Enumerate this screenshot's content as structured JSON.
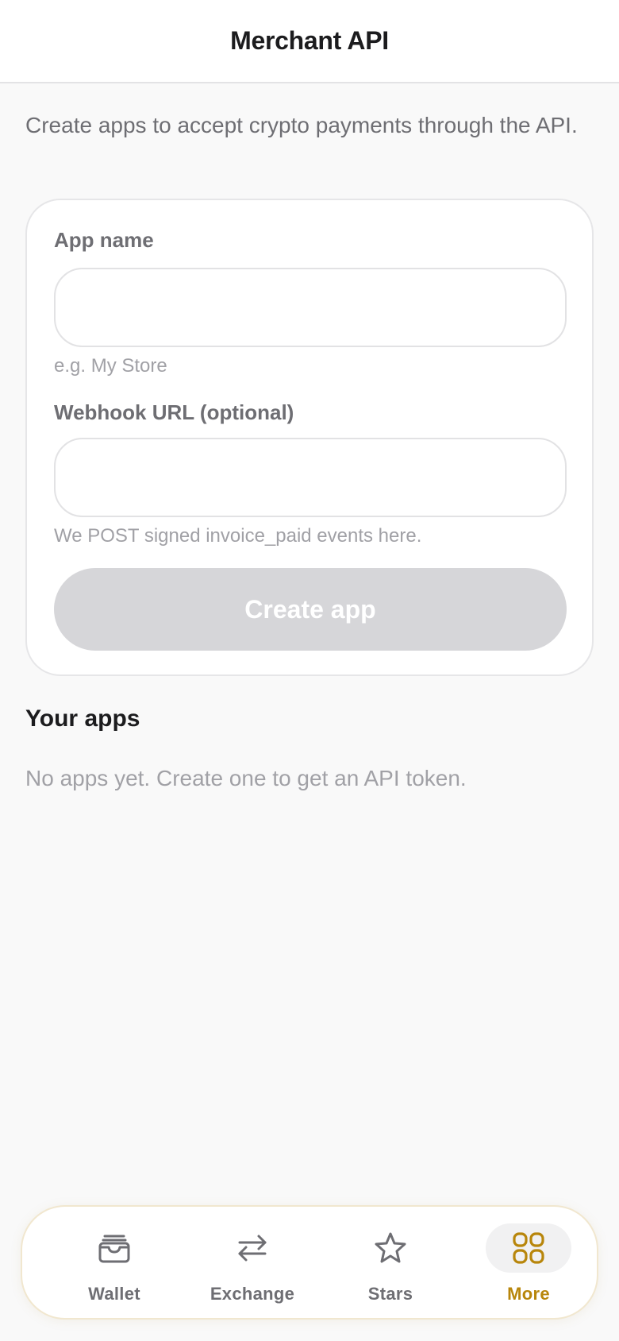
{
  "header": {
    "title": "Merchant API"
  },
  "intro": "Create apps to accept crypto payments through the API.",
  "form": {
    "app_name": {
      "label": "App name",
      "value": "",
      "hint": "e.g. My Store"
    },
    "webhook": {
      "label": "Webhook URL (optional)",
      "value": "",
      "hint": "We POST signed invoice_paid events here."
    },
    "create_label": "Create app"
  },
  "apps": {
    "title": "Your apps",
    "empty": "No apps yet. Create one to get an API token."
  },
  "tabbar": {
    "active_color": "#b8860b",
    "items": [
      {
        "label": "Wallet",
        "icon": "wallet-icon",
        "active": false
      },
      {
        "label": "Exchange",
        "icon": "exchange-icon",
        "active": false
      },
      {
        "label": "Stars",
        "icon": "star-icon",
        "active": false
      },
      {
        "label": "More",
        "icon": "grid-icon",
        "active": true
      }
    ]
  }
}
